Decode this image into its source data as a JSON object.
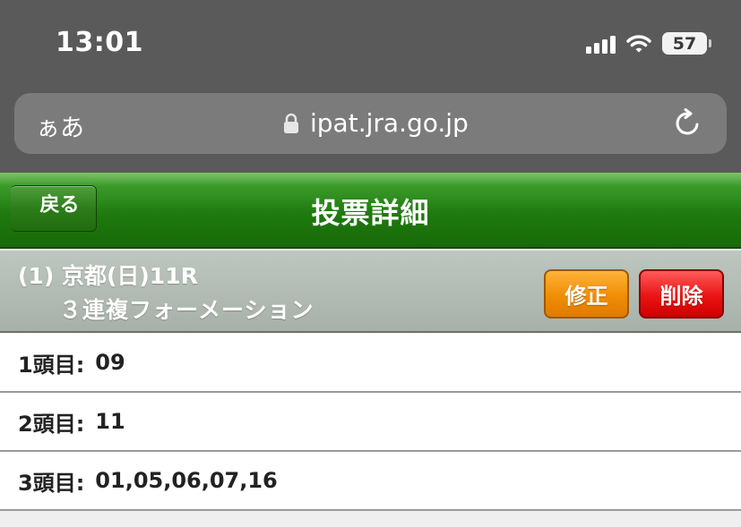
{
  "status_bar": {
    "time": "13:01",
    "battery": "57",
    "icons": [
      "signal-icon",
      "wifi-icon",
      "battery-icon"
    ]
  },
  "address_bar": {
    "reader_label": "ぁあ",
    "url": "ipat.jra.go.jp",
    "icons": [
      "lock-icon",
      "reload-icon"
    ]
  },
  "header": {
    "back_label": "戻る",
    "title": "投票詳細"
  },
  "race": {
    "title": "(1) 京都(日)11R",
    "bet_type": "３連複フォーメーション",
    "edit_label": "修正",
    "delete_label": "削除"
  },
  "selections": [
    {
      "label": "1頭目:",
      "value": "09"
    },
    {
      "label": "2頭目:",
      "value": "11"
    },
    {
      "label": "3頭目:",
      "value": "01,05,06,07,16"
    }
  ],
  "colors": {
    "header_green": "#1f7a0f",
    "edit_orange": "#f08d05",
    "delete_red": "#ea1414",
    "race_bar_gray": "#a7b1a9"
  }
}
